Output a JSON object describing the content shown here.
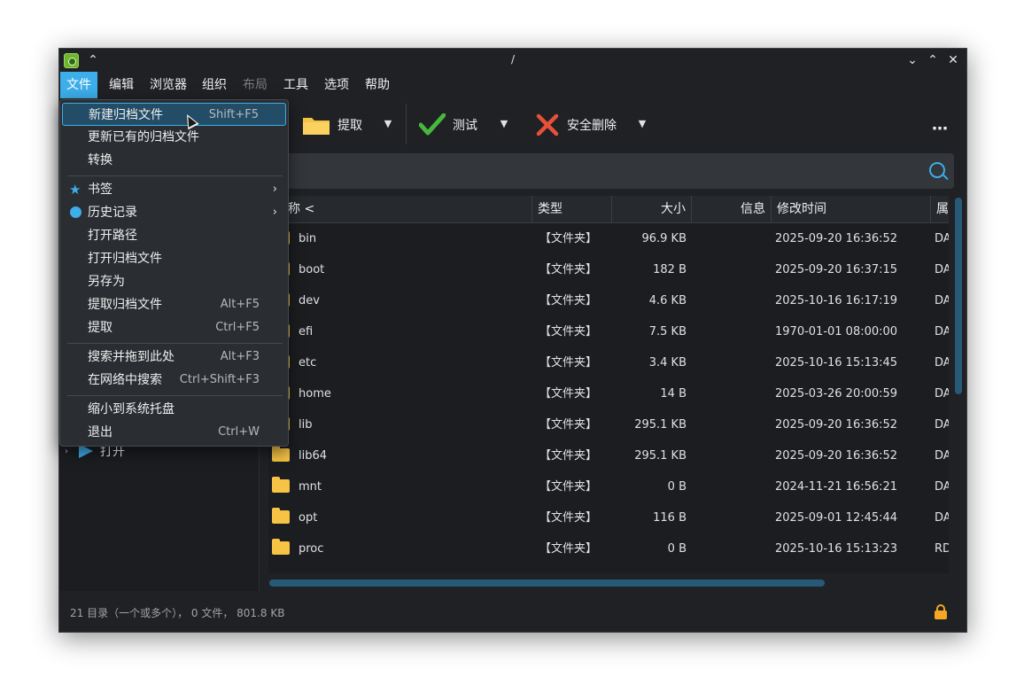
{
  "window": {
    "title": "/"
  },
  "menubar": {
    "items": [
      {
        "label": "文件",
        "state": "active"
      },
      {
        "label": "编辑",
        "state": "normal"
      },
      {
        "label": "浏览器",
        "state": "normal"
      },
      {
        "label": "组织",
        "state": "normal"
      },
      {
        "label": "布局",
        "state": "disabled"
      },
      {
        "label": "工具",
        "state": "normal"
      },
      {
        "label": "选项",
        "state": "normal"
      },
      {
        "label": "帮助",
        "state": "normal"
      }
    ]
  },
  "toolbar": {
    "extract_label": "提取",
    "test_label": "测试",
    "delete_label": "安全删除",
    "more_label": "⋯"
  },
  "file_menu": {
    "new_archive": {
      "label": "新建归档文件",
      "shortcut": "Shift+F5"
    },
    "update_archive": {
      "label": "更新已有的归档文件"
    },
    "convert": {
      "label": "转换"
    },
    "bookmarks": {
      "label": "书签"
    },
    "history": {
      "label": "历史记录"
    },
    "open_path": {
      "label": "打开路径"
    },
    "open_archive": {
      "label": "打开归档文件"
    },
    "save_as": {
      "label": "另存为"
    },
    "extract_archive": {
      "label": "提取归档文件",
      "shortcut": "Alt+F5"
    },
    "extract": {
      "label": "提取",
      "shortcut": "Ctrl+F5"
    },
    "search_drag": {
      "label": "搜索并拖到此处",
      "shortcut": "Alt+F3"
    },
    "web_search": {
      "label": "在网络中搜索",
      "shortcut": "Ctrl+Shift+F3"
    },
    "minimize_tray": {
      "label": "缩小到系统托盘"
    },
    "quit": {
      "label": "退出",
      "shortcut": "Ctrl+W"
    }
  },
  "sidebar": {
    "open_label": "打开"
  },
  "table": {
    "headers": {
      "name": "称 <",
      "type": "类型",
      "size": "大小",
      "info": "信息",
      "modified": "修改时间",
      "attr": "属"
    },
    "rows": [
      {
        "name": "bin",
        "type": "【文件夹】",
        "size": "96.9 KB",
        "modified": "2025-09-20 16:36:52",
        "attr": "DA"
      },
      {
        "name": "boot",
        "type": "【文件夹】",
        "size": "182 B",
        "modified": "2025-09-20 16:37:15",
        "attr": "DA"
      },
      {
        "name": "dev",
        "type": "【文件夹】",
        "size": "4.6 KB",
        "modified": "2025-10-16 16:17:19",
        "attr": "DA"
      },
      {
        "name": "efi",
        "type": "【文件夹】",
        "size": "7.5 KB",
        "modified": "1970-01-01 08:00:00",
        "attr": "DA"
      },
      {
        "name": "etc",
        "type": "【文件夹】",
        "size": "3.4 KB",
        "modified": "2025-10-16 15:13:45",
        "attr": "DA"
      },
      {
        "name": "home",
        "type": "【文件夹】",
        "size": "14 B",
        "modified": "2025-03-26 20:00:59",
        "attr": "DA"
      },
      {
        "name": "lib",
        "type": "【文件夹】",
        "size": "295.1 KB",
        "modified": "2025-09-20 16:36:52",
        "attr": "DA"
      },
      {
        "name": "lib64",
        "type": "【文件夹】",
        "size": "295.1 KB",
        "modified": "2025-09-20 16:36:52",
        "attr": "DA"
      },
      {
        "name": "mnt",
        "type": "【文件夹】",
        "size": "0 B",
        "modified": "2024-11-21 16:56:21",
        "attr": "DA"
      },
      {
        "name": "opt",
        "type": "【文件夹】",
        "size": "116 B",
        "modified": "2025-09-01 12:45:44",
        "attr": "DA"
      },
      {
        "name": "proc",
        "type": "【文件夹】",
        "size": "0 B",
        "modified": "2025-10-16 15:13:23",
        "attr": "RD"
      }
    ]
  },
  "status": {
    "summary": "21 目录（一个或多个）， 0 文件， 801.8 KB"
  },
  "colors": {
    "accent": "#3daee9",
    "folder": "#f6c344",
    "background": "#1b1d20",
    "lock": "#f6a623"
  }
}
